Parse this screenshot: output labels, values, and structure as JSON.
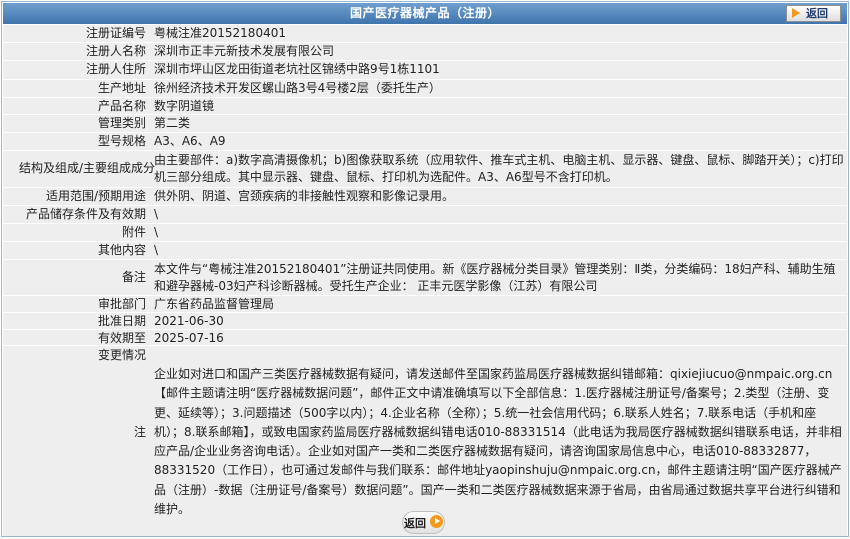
{
  "header": {
    "title": "国产医疗器械产品（注册）",
    "back_label": "返回"
  },
  "fields": [
    {
      "label": "注册证编号",
      "value": "粤械注准20152180401"
    },
    {
      "label": "注册人名称",
      "value": "深圳市正丰元新技术发展有限公司"
    },
    {
      "label": "注册人住所",
      "value": "深圳市坪山区龙田街道老坑社区锦绣中路9号1栋1101"
    },
    {
      "label": "生产地址",
      "value": "徐州经济技术开发区螺山路3号4号楼2层（委托生产）"
    },
    {
      "label": "产品名称",
      "value": "数字阴道镜"
    },
    {
      "label": "管理类别",
      "value": "第二类"
    },
    {
      "label": "型号规格",
      "value": "A3、A6、A9"
    },
    {
      "label": "结构及组成/主要组成成分",
      "value": "由主要部件：a)数字高清摄像机；b)图像获取系统（应用软件、推车式主机、电脑主机、显示器、键盘、鼠标、脚踏开关）；c)打印机三部分组成。其中显示器、键盘、鼠标、打印机为选配件。A3、A6型号不含打印机。"
    },
    {
      "label": "适用范围/预期用途",
      "value": "供外阴、阴道、宫颈疾病的非接触性观察和影像记录用。"
    },
    {
      "label": "产品储存条件及有效期",
      "value": "\\"
    },
    {
      "label": "附件",
      "value": "\\"
    },
    {
      "label": "其他内容",
      "value": "\\"
    },
    {
      "label": "备注",
      "value": "本文件与“粤械注准20152180401”注册证共同使用。新《医疗器械分类目录》管理类别：Ⅱ类，分类编码：18妇产科、辅助生殖和避孕器械-03妇产科诊断器械。受托生产企业： 正丰元医学影像（江苏）有限公司"
    },
    {
      "label": "审批部门",
      "value": "广东省药品监督管理局"
    },
    {
      "label": "批准日期",
      "value": "2021-06-30"
    },
    {
      "label": "有效期至",
      "value": "2025-07-16"
    }
  ],
  "notes": {
    "label_change": "变更情况",
    "label_note": "注",
    "text": "企业如对进口和国产三类医疗器械数据有疑问，请发送邮件至国家药监局医疗器械数据纠错邮箱：qixiejiucuo@nmpaic.org.cn【邮件主题请注明“医疗器械数据问题”，邮件正文中请准确填写以下全部信息：1.医疗器械注册证号/备案号；2.类型（注册、变更、延续等）；3.问题描述（500字以内）；4.企业名称（全称）；5.统一社会信用代码；6.联系人姓名；7.联系电话（手机和座机）；8.联系邮箱】，或致电国家药监局医疗器械数据纠错电话010-88331514（此电话为我局医疗器械数据纠错联系电话，并非相应产品/企业业务咨询电话）。企业如对国产一类和二类医疗器械数据有疑问，请咨询国家局信息中心，电话010-88332877，88331520（工作日），也可通过发邮件与我们联系：邮件地址yaopinshuju@nmpaic.org.cn，邮件主题请注明“国产医疗器械产品（注册）-数据（注册证号/备案号）数据问题”。国产一类和二类医疗器械数据来源于省局，由省局通过数据共享平台进行纠错和维护。"
  },
  "footer": {
    "back_label": "返回"
  },
  "colors": {
    "header": "#4a7fb6",
    "row_bg": "#eeeeee",
    "accent": "#f39a1e"
  }
}
